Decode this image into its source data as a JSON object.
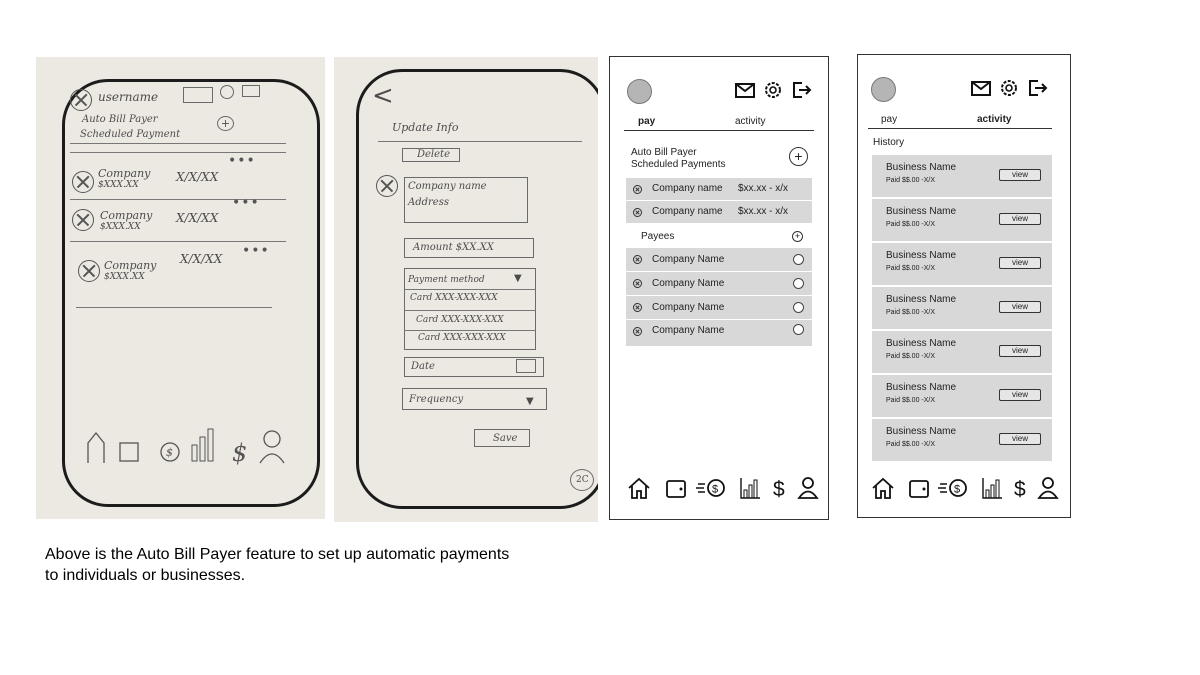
{
  "caption": "Above is the Auto Bill Payer feature to set up automatic payments to individuals or businesses.",
  "sketch1": {
    "username": "username",
    "title_line1": "Auto Bill Payer",
    "title_line2": "Scheduled Payment",
    "rows": [
      {
        "company": "Company",
        "amount": "$XXX.XX",
        "date": "X/X/XX"
      },
      {
        "company": "Company",
        "amount": "$XXX.XX",
        "date": "X/X/XX"
      },
      {
        "company": "Company",
        "amount": "$XXX.XX",
        "date": "X/X/XX"
      }
    ]
  },
  "sketch2": {
    "back": "<",
    "update_info": "Update Info",
    "delete": "Delete",
    "company_name": "Company name",
    "address": "Address",
    "amount": "Amount $XX.XX",
    "payment_method": "Payment method",
    "cards": [
      "Card XXX-XXX-XXX",
      "Card XXX-XXX-XXX",
      "Card XXX-XXX-XXX"
    ],
    "date": "Date",
    "frequency": "Frequency",
    "save": "Save",
    "page_marker": "2C"
  },
  "screen_pay": {
    "tabs": {
      "pay": "pay",
      "activity": "activity"
    },
    "section_title_line1": "Auto Bill Payer",
    "section_title_line2": "Scheduled Payments",
    "add_symbol": "+",
    "scheduled": [
      {
        "name": "Company name",
        "amount": "$xx.xx - x/x"
      },
      {
        "name": "Company name",
        "amount": "$xx.xx - x/x"
      }
    ],
    "payees_label": "Payees",
    "payees": [
      "Company Name",
      "Company Name",
      "Company Name",
      "Company Name"
    ]
  },
  "screen_activity": {
    "tabs": {
      "pay": "pay",
      "activity": "activity"
    },
    "history_label": "History",
    "items": [
      {
        "name": "Business Name",
        "paid": "Paid $$.00 -X/X",
        "view": "view"
      },
      {
        "name": "Business Name",
        "paid": "Paid $$.00 -X/X",
        "view": "view"
      },
      {
        "name": "Business Name",
        "paid": "Paid $$.00 -X/X",
        "view": "view"
      },
      {
        "name": "Business Name",
        "paid": "Paid $$.00 -X/X",
        "view": "view"
      },
      {
        "name": "Business Name",
        "paid": "Paid $$.00 -X/X",
        "view": "view"
      },
      {
        "name": "Business Name",
        "paid": "Paid $$.00 -X/X",
        "view": "view"
      },
      {
        "name": "Business Name",
        "paid": "Paid $$.00 -X/X",
        "view": "view"
      }
    ]
  },
  "icons": {
    "top": [
      "mail-icon",
      "gear-icon",
      "logout-icon"
    ],
    "nav": [
      "home-icon",
      "wallet-icon",
      "send-money-icon",
      "chart-icon",
      "dollar-icon",
      "profile-icon"
    ]
  }
}
